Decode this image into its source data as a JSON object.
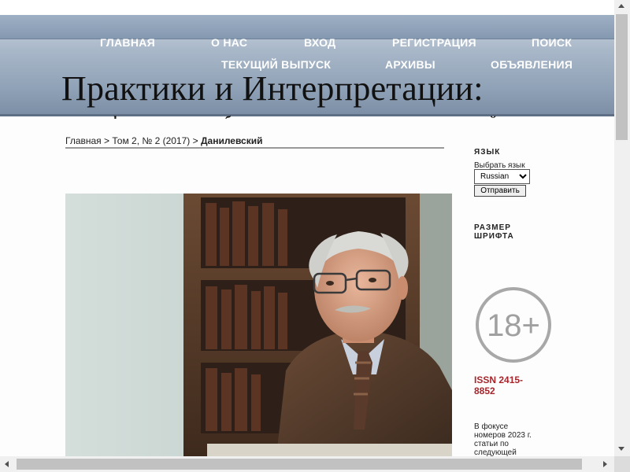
{
  "nav": {
    "row1": [
      {
        "label": "ГЛАВНАЯ"
      },
      {
        "label": "О НАС"
      },
      {
        "label": "ВХОД"
      },
      {
        "label": "РЕГИСТРАЦИЯ"
      },
      {
        "label": "ПОИСК"
      }
    ],
    "row2": [
      {
        "label": "ТЕКУЩИЙ ВЫПУСК"
      },
      {
        "label": "АРХИВЫ"
      },
      {
        "label": "ОБЪЯВЛЕНИЯ"
      }
    ]
  },
  "header": {
    "title": "Практики и Интерпретации:",
    "subtitle": "журнал филологических, образовательных и культурных исследований"
  },
  "breadcrumb": {
    "home": "Главная",
    "sep1": " > ",
    "issue": "Том 2, № 2 (2017)",
    "sep2": " > ",
    "current": "Данилевский"
  },
  "sidebar": {
    "language_title": "ЯЗЫК",
    "language_label": "Выбрать язык",
    "language_selected": "Russian",
    "submit_label": "Отправить",
    "font_size_title": "РАЗМЕР ШРИФТА",
    "age_rating": "18+",
    "issn": "ISSN 2415-8852",
    "focus_text": "В фокусе номеров 2023 г. статьи по следующей"
  },
  "colors": {
    "issn": "#a6262c",
    "header_gradient_top": "#c9d3df",
    "header_gradient_bottom": "#7d8fa6"
  }
}
